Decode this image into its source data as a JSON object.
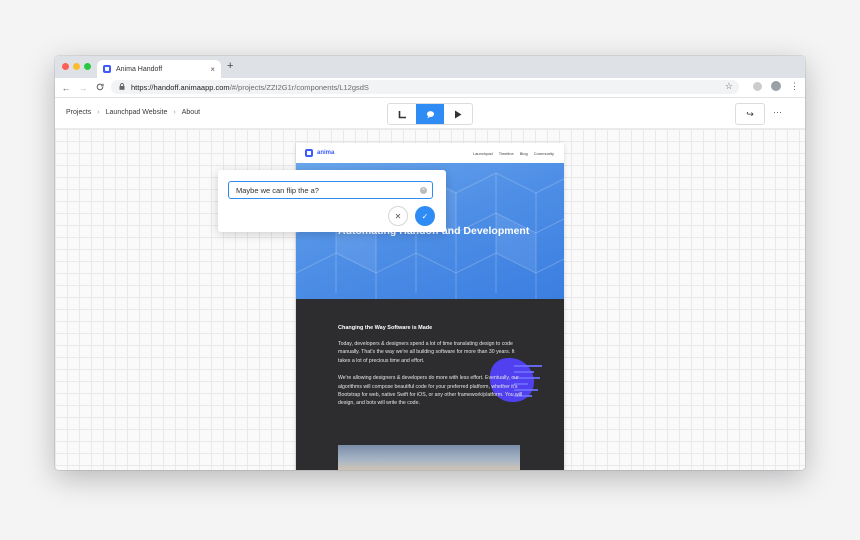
{
  "browser": {
    "tab_title": "Anima Handoff",
    "tab_close": "×",
    "new_tab": "+",
    "url_host": "https://handoff.animaapp.com",
    "url_path": "/#/projects/ZZI2G1r/components/L12gsdS",
    "back": "←",
    "forward": "→",
    "reload": "C",
    "star": "☆",
    "kebab": "⋮"
  },
  "header": {
    "breadcrumb": [
      "Projects",
      "Launchpad Website",
      "About"
    ],
    "breadcrumb_sep": "›",
    "modes": [
      "inspect-icon",
      "comment-icon",
      "play-icon"
    ],
    "active_mode": "comment",
    "share": "↪",
    "more": "···"
  },
  "artboard": {
    "logo": "anima",
    "nav_links": [
      "Launchpad",
      "Timeline",
      "Blog",
      "Community"
    ],
    "hero_title": "Automating Handoff and Development",
    "section_title": "Changing the Way Software is Made",
    "paragraph_1": "Today, developers & designers spend a lot of time translating design to code manually. That's the way we're all building software for more than 30 years. It takes a lot of precious time and effort.",
    "paragraph_2": "We're allowing designers & developers do more with less effort. Eventually, our algorithms will compose beautiful code for your preferred platform, whether it's Bootstrap for web, native Swift for iOS, or any other framework/platform. You will design, and bots will write the code."
  },
  "comment": {
    "value": "Maybe we can flip the a?",
    "cancel": "✕",
    "confirm": "✓"
  },
  "colors": {
    "accent": "#2f8cf5",
    "brand": "#3d5afe"
  }
}
